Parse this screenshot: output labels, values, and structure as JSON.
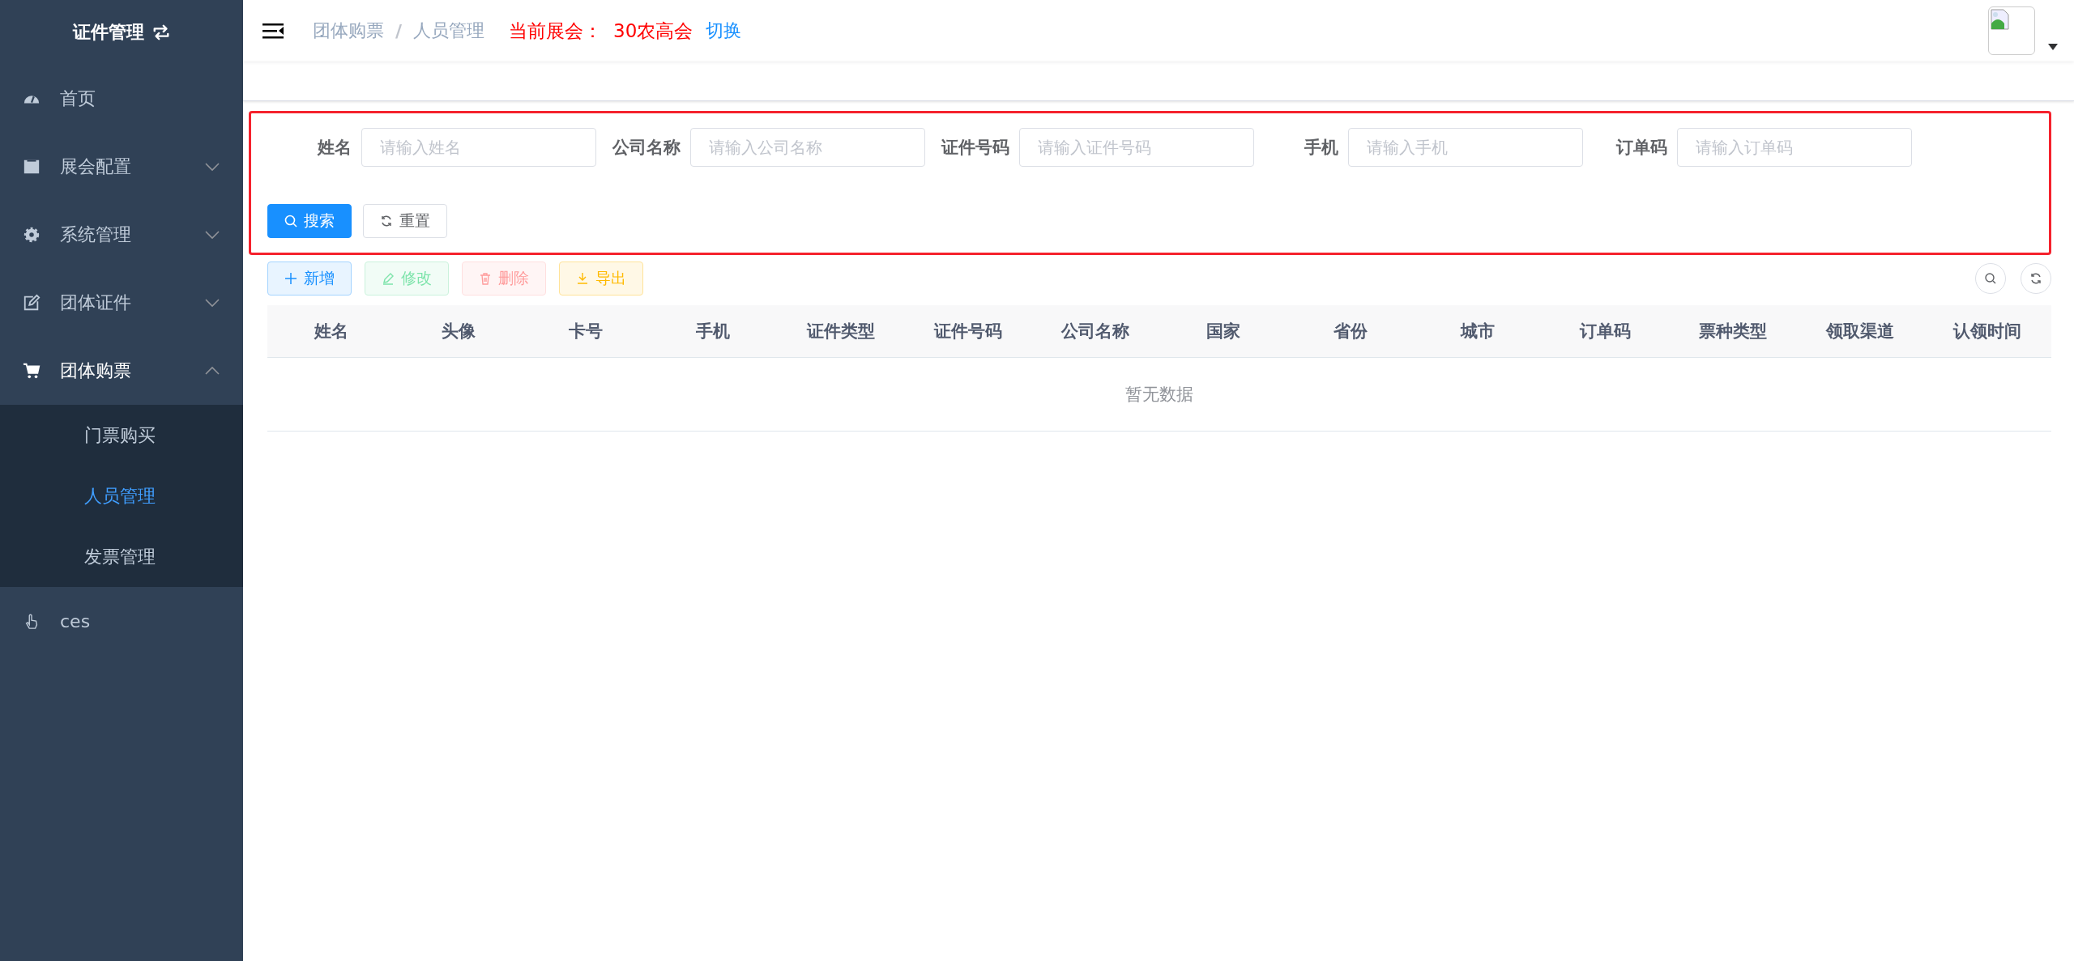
{
  "sidebar": {
    "title": "证件管理",
    "items": [
      {
        "label": "首页",
        "kind": "link",
        "expanded": false
      },
      {
        "label": "展会配置",
        "kind": "submenu",
        "expanded": false
      },
      {
        "label": "系统管理",
        "kind": "submenu",
        "expanded": false
      },
      {
        "label": "团体证件",
        "kind": "submenu",
        "expanded": false
      },
      {
        "label": "团体购票",
        "kind": "submenu",
        "expanded": true,
        "children": [
          {
            "label": "门票购买",
            "selected": false
          },
          {
            "label": "人员管理",
            "selected": true
          },
          {
            "label": "发票管理",
            "selected": false
          }
        ]
      },
      {
        "label": "ces",
        "kind": "link",
        "expanded": false
      }
    ]
  },
  "header": {
    "breadcrumb": [
      "团体购票",
      "人员管理"
    ],
    "separator": "/",
    "exhibition_label": "当前展会：",
    "exhibition_name": "30农高会",
    "switch_link": "切换"
  },
  "filter": {
    "fields": [
      {
        "label": "姓名",
        "placeholder": "请输入姓名"
      },
      {
        "label": "公司名称",
        "placeholder": "请输入公司名称"
      },
      {
        "label": "证件号码",
        "placeholder": "请输入证件号码"
      },
      {
        "label": "手机",
        "placeholder": "请输入手机"
      },
      {
        "label": "订单码",
        "placeholder": "请输入订单码"
      }
    ],
    "buttons": [
      {
        "label": "搜索",
        "kind": "primary"
      },
      {
        "label": "重置",
        "kind": "default"
      }
    ]
  },
  "toolbar": [
    {
      "label": "新增",
      "kind": "add",
      "disabled": false
    },
    {
      "label": "修改",
      "kind": "edit",
      "disabled": true
    },
    {
      "label": "删除",
      "kind": "delete",
      "disabled": true
    },
    {
      "label": "导出",
      "kind": "export",
      "disabled": false
    }
  ],
  "table": {
    "columns": [
      "姓名",
      "头像",
      "卡号",
      "手机",
      "证件类型",
      "证件号码",
      "公司名称",
      "国家",
      "省份",
      "城市",
      "订单码",
      "票种类型",
      "领取渠道",
      "认领时间"
    ],
    "empty_text": "暂无数据"
  }
}
